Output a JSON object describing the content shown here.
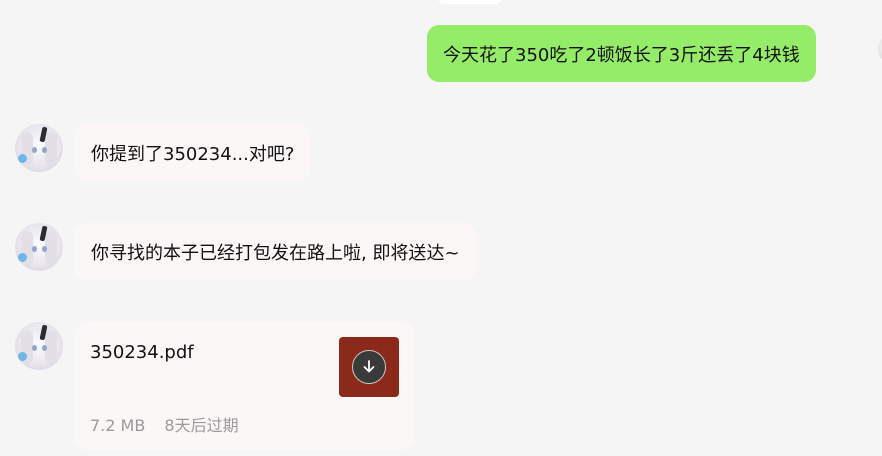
{
  "messages": [
    {
      "direction": "outgoing",
      "text": "今天花了350吃了2顿饭长了3斤还丢了4块钱"
    },
    {
      "direction": "incoming",
      "text": "你提到了350234...对吧?"
    },
    {
      "direction": "incoming",
      "text": "你寻找的本子已经打包发在路上啦, 即将送达~"
    }
  ],
  "file_message": {
    "file_name": "350234.pdf",
    "file_size": "7.2 MB",
    "expiry": "8天后过期",
    "icon": "download-icon",
    "icon_color": "#8b2a1a"
  },
  "colors": {
    "background": "#f5f5f5",
    "outgoing_bubble": "#95ec69",
    "incoming_bubble": "#fbf7f6"
  }
}
